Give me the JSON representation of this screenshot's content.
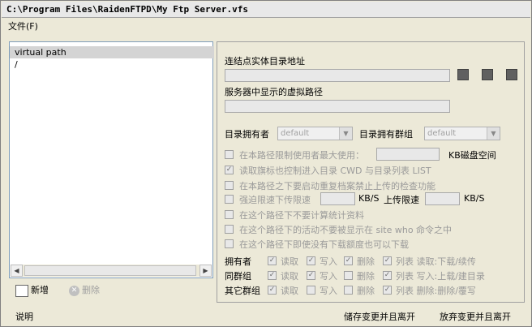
{
  "window": {
    "title": "C:\\Program Files\\RaidenFTPD\\My Ftp Server.vfs"
  },
  "menu": {
    "file": "文件(F)"
  },
  "left": {
    "header": "virtual path",
    "rows": [
      "/"
    ],
    "add_label": "新增",
    "delete_label": "删除"
  },
  "right": {
    "physical_dir_label": "连结点实体目录地址",
    "virtual_path_label": "服务器中显示的虚拟路径",
    "owner_label": "目录拥有者",
    "owner_value": "default",
    "group_label": "目录拥有群组",
    "group_value": "default",
    "opt_limit_users": "在本路径限制使用者最大使用：",
    "opt_limit_users_unit": "KB磁盘空间",
    "opt_read_flag": "读取旗标也控制进入目录 CWD 与目录列表 LIST",
    "opt_dup_check": "在本路径之下要启动重复档案禁止上传的检查功能",
    "opt_speed_limit": "强迫限速下传限速",
    "opt_speed_unit1": "KB/S",
    "opt_upload_limit": "上传限速",
    "opt_speed_unit2": "KB/S",
    "opt_no_stats": "在这个路径下不要计算统计资料",
    "opt_hide_site_who": "在这个路径下的活动不要被显示在 site who 命令之中",
    "opt_no_ratio": "在这个路径下即使没有下载额度也可以下载",
    "perm_rows": [
      {
        "name": "拥有者",
        "read": "读取",
        "write": "写入",
        "delete": "删除",
        "list": "列表 读取:下载/续传"
      },
      {
        "name": "同群组",
        "read": "读取",
        "write": "写入",
        "delete": "删除",
        "list": "列表 写入:上载/建目录"
      },
      {
        "name": "其它群组",
        "read": "读取",
        "write": "写入",
        "delete": "删除",
        "list": "列表 删除:删除/覆写"
      }
    ]
  },
  "status": {
    "help": "说明",
    "save_exit": "储存变更并且离开",
    "discard_exit": "放弃变更并且离开"
  }
}
